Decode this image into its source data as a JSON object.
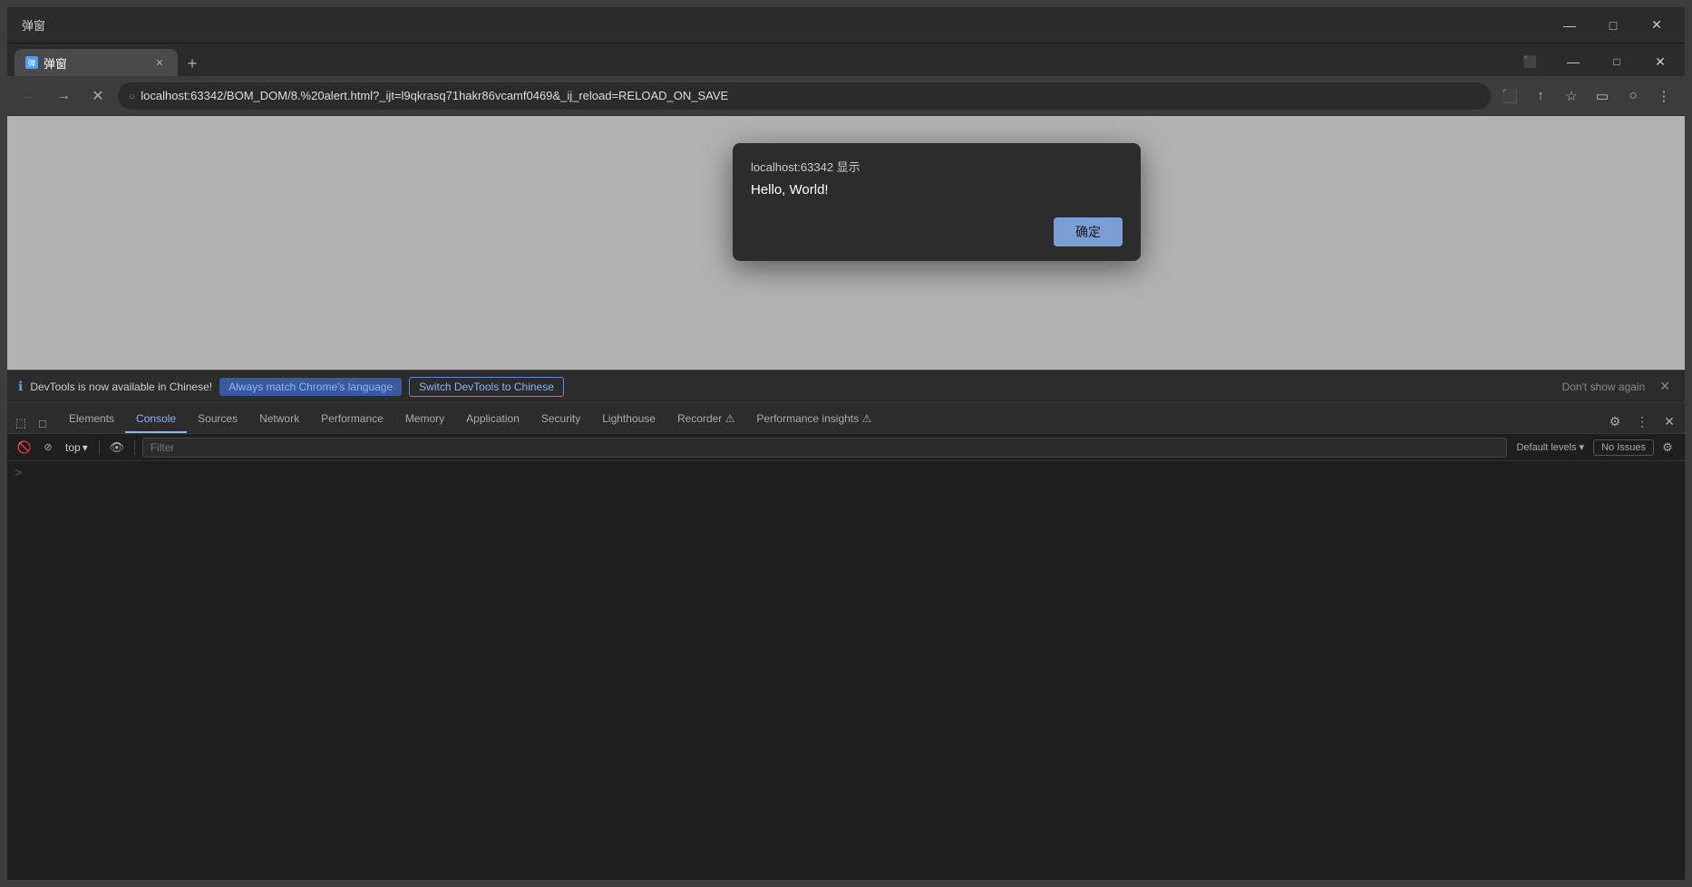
{
  "window": {
    "title": "弹窗",
    "controls": {
      "restore": "🗗",
      "minimize": "—",
      "maximize": "□",
      "close": "✕"
    }
  },
  "tab": {
    "favicon": "弹",
    "label": "弹窗",
    "close": "✕"
  },
  "tab_new": "+",
  "addressbar": {
    "url": "localhost:63342/BOM_DOM/8.%20alert.html?_ijt=l9qkrasq71hakr86vcamf0469&_ij_reload=RELOAD_ON_SAVE",
    "lock_icon": "○"
  },
  "toolbar": {
    "back": "←",
    "forward": "→",
    "reload": "✕",
    "screenshot": "⬛",
    "share": "↑",
    "bookmark": "☆",
    "sidebar": "▭",
    "profile": "○",
    "more": "⋮"
  },
  "alert_dialog": {
    "header": "localhost:63342 显示",
    "message": "Hello, World!",
    "ok_button": "确定"
  },
  "devtools": {
    "notification": {
      "icon": "ℹ",
      "text": "DevTools is now available in Chinese!",
      "btn1": "Always match Chrome's language",
      "btn2": "Switch DevTools to Chinese",
      "dismiss": "Don't show again",
      "close": "✕"
    },
    "tabs": [
      {
        "label": "Elements",
        "active": false
      },
      {
        "label": "Console",
        "active": true
      },
      {
        "label": "Sources",
        "active": false
      },
      {
        "label": "Network",
        "active": false
      },
      {
        "label": "Performance",
        "active": false
      },
      {
        "label": "Memory",
        "active": false
      },
      {
        "label": "Application",
        "active": false
      },
      {
        "label": "Security",
        "active": false
      },
      {
        "label": "Lighthouse",
        "active": false
      },
      {
        "label": "Recorder ⚠",
        "active": false
      },
      {
        "label": "Performance insights ⚠",
        "active": false
      }
    ],
    "tabs_icons": {
      "inspect": "⬚",
      "device": "□",
      "settings": "⚙",
      "more": "⋮",
      "close": "✕"
    },
    "toolbar": {
      "clear": "🚫",
      "filter_placeholder": "Filter",
      "top_label": "top",
      "eye_icon": "👁",
      "default_levels": "Default levels ▾",
      "no_issues": "No Issues",
      "settings": "⚙"
    },
    "console_prompt": ">"
  }
}
